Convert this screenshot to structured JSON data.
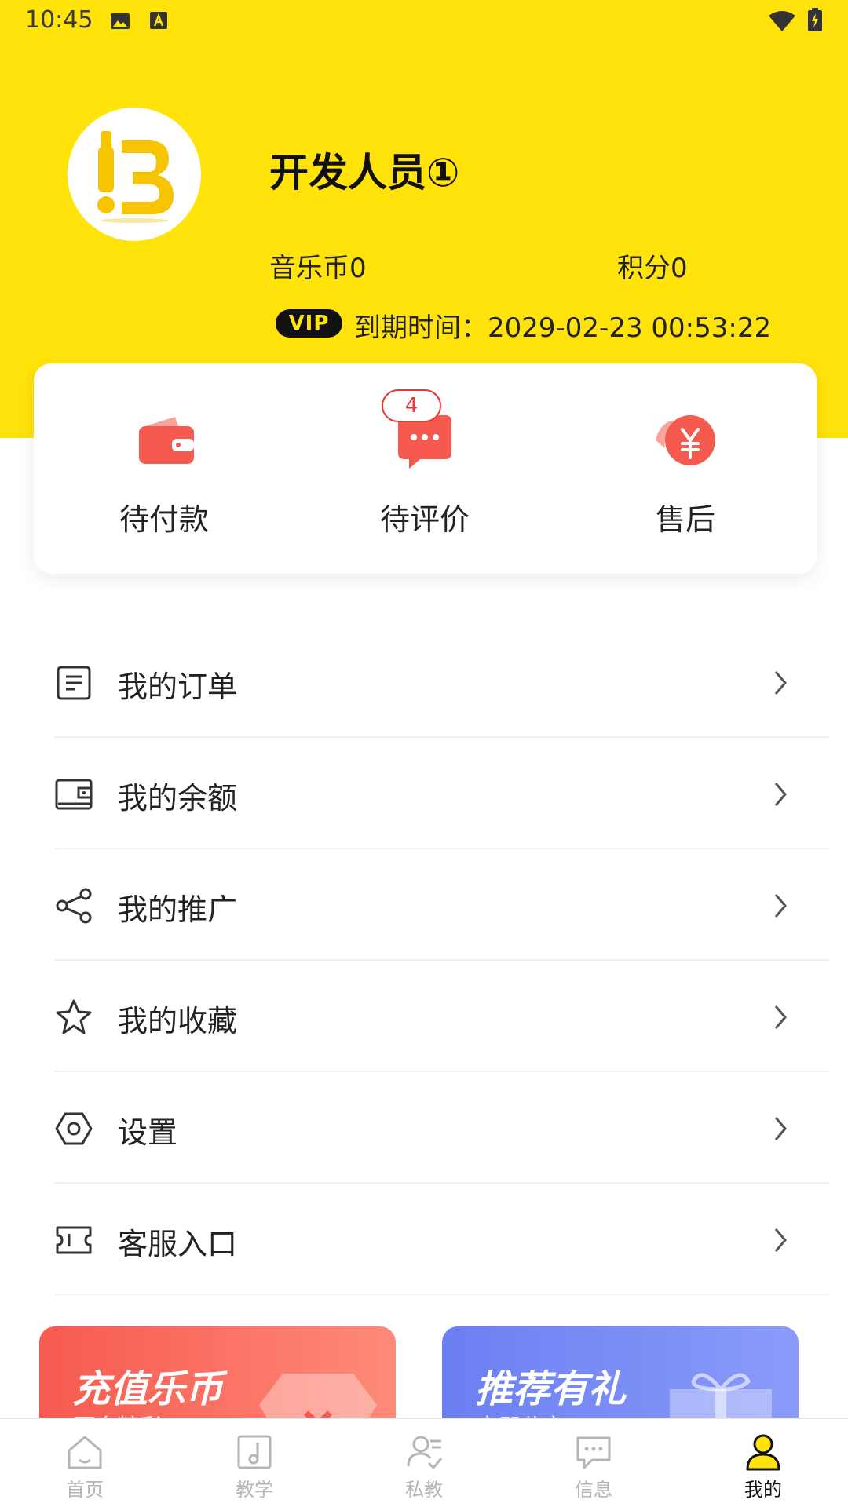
{
  "status_bar": {
    "time": "10:45"
  },
  "profile": {
    "name": "开发人员①",
    "coins_label": "音乐币0",
    "points_label": "积分0",
    "vip_badge": "VIP",
    "vip_expiry": "到期时间：2029-02-23 00:53:22"
  },
  "orders": [
    {
      "label": "待付款",
      "icon": "wallet-icon"
    },
    {
      "label": "待评价",
      "icon": "comment-icon",
      "badge": "4"
    },
    {
      "label": "售后",
      "icon": "refund-icon"
    }
  ],
  "menu": [
    {
      "label": "我的订单",
      "icon": "order-list-icon"
    },
    {
      "label": "我的余额",
      "icon": "balance-wallet-icon"
    },
    {
      "label": "我的推广",
      "icon": "share-icon"
    },
    {
      "label": "我的收藏",
      "icon": "star-icon"
    },
    {
      "label": "设置",
      "icon": "settings-icon"
    },
    {
      "label": "客服入口",
      "icon": "ticket-icon"
    }
  ],
  "promos": [
    {
      "title": "充值乐币",
      "subtitle": "更多精彩"
    },
    {
      "title": "推荐有礼",
      "subtitle": "立即分享"
    }
  ],
  "tabs": [
    {
      "label": "首页",
      "icon": "home-icon"
    },
    {
      "label": "教学",
      "icon": "music-note-icon"
    },
    {
      "label": "私教",
      "icon": "tutor-icon"
    },
    {
      "label": "信息",
      "icon": "message-icon"
    },
    {
      "label": "我的",
      "icon": "profile-icon",
      "active": true
    }
  ],
  "colors": {
    "brand_yellow": "#FFE30A",
    "badge_red": "#e53935",
    "promo_red": "#f65a4f",
    "promo_blue": "#6b7ff2"
  }
}
